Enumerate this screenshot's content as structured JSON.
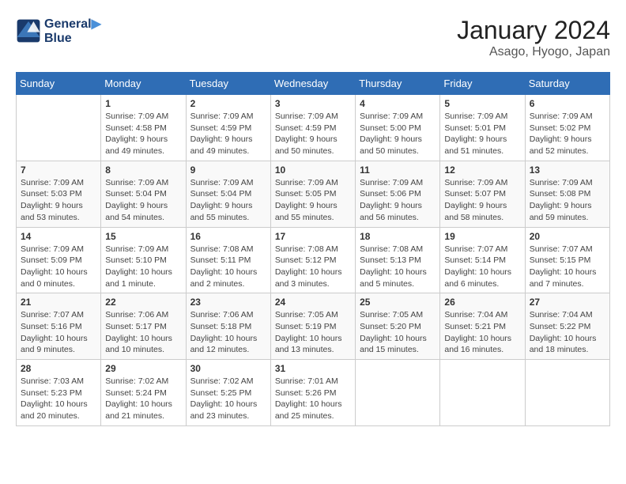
{
  "header": {
    "logo_line1": "General",
    "logo_line2": "Blue",
    "title": "January 2024",
    "subtitle": "Asago, Hyogo, Japan"
  },
  "days_of_week": [
    "Sunday",
    "Monday",
    "Tuesday",
    "Wednesday",
    "Thursday",
    "Friday",
    "Saturday"
  ],
  "weeks": [
    [
      {
        "day": "",
        "info": ""
      },
      {
        "day": "1",
        "info": "Sunrise: 7:09 AM\nSunset: 4:58 PM\nDaylight: 9 hours\nand 49 minutes."
      },
      {
        "day": "2",
        "info": "Sunrise: 7:09 AM\nSunset: 4:59 PM\nDaylight: 9 hours\nand 49 minutes."
      },
      {
        "day": "3",
        "info": "Sunrise: 7:09 AM\nSunset: 4:59 PM\nDaylight: 9 hours\nand 50 minutes."
      },
      {
        "day": "4",
        "info": "Sunrise: 7:09 AM\nSunset: 5:00 PM\nDaylight: 9 hours\nand 50 minutes."
      },
      {
        "day": "5",
        "info": "Sunrise: 7:09 AM\nSunset: 5:01 PM\nDaylight: 9 hours\nand 51 minutes."
      },
      {
        "day": "6",
        "info": "Sunrise: 7:09 AM\nSunset: 5:02 PM\nDaylight: 9 hours\nand 52 minutes."
      }
    ],
    [
      {
        "day": "7",
        "info": "Sunrise: 7:09 AM\nSunset: 5:03 PM\nDaylight: 9 hours\nand 53 minutes."
      },
      {
        "day": "8",
        "info": "Sunrise: 7:09 AM\nSunset: 5:04 PM\nDaylight: 9 hours\nand 54 minutes."
      },
      {
        "day": "9",
        "info": "Sunrise: 7:09 AM\nSunset: 5:04 PM\nDaylight: 9 hours\nand 55 minutes."
      },
      {
        "day": "10",
        "info": "Sunrise: 7:09 AM\nSunset: 5:05 PM\nDaylight: 9 hours\nand 55 minutes."
      },
      {
        "day": "11",
        "info": "Sunrise: 7:09 AM\nSunset: 5:06 PM\nDaylight: 9 hours\nand 56 minutes."
      },
      {
        "day": "12",
        "info": "Sunrise: 7:09 AM\nSunset: 5:07 PM\nDaylight: 9 hours\nand 58 minutes."
      },
      {
        "day": "13",
        "info": "Sunrise: 7:09 AM\nSunset: 5:08 PM\nDaylight: 9 hours\nand 59 minutes."
      }
    ],
    [
      {
        "day": "14",
        "info": "Sunrise: 7:09 AM\nSunset: 5:09 PM\nDaylight: 10 hours\nand 0 minutes."
      },
      {
        "day": "15",
        "info": "Sunrise: 7:09 AM\nSunset: 5:10 PM\nDaylight: 10 hours\nand 1 minute."
      },
      {
        "day": "16",
        "info": "Sunrise: 7:08 AM\nSunset: 5:11 PM\nDaylight: 10 hours\nand 2 minutes."
      },
      {
        "day": "17",
        "info": "Sunrise: 7:08 AM\nSunset: 5:12 PM\nDaylight: 10 hours\nand 3 minutes."
      },
      {
        "day": "18",
        "info": "Sunrise: 7:08 AM\nSunset: 5:13 PM\nDaylight: 10 hours\nand 5 minutes."
      },
      {
        "day": "19",
        "info": "Sunrise: 7:07 AM\nSunset: 5:14 PM\nDaylight: 10 hours\nand 6 minutes."
      },
      {
        "day": "20",
        "info": "Sunrise: 7:07 AM\nSunset: 5:15 PM\nDaylight: 10 hours\nand 7 minutes."
      }
    ],
    [
      {
        "day": "21",
        "info": "Sunrise: 7:07 AM\nSunset: 5:16 PM\nDaylight: 10 hours\nand 9 minutes."
      },
      {
        "day": "22",
        "info": "Sunrise: 7:06 AM\nSunset: 5:17 PM\nDaylight: 10 hours\nand 10 minutes."
      },
      {
        "day": "23",
        "info": "Sunrise: 7:06 AM\nSunset: 5:18 PM\nDaylight: 10 hours\nand 12 minutes."
      },
      {
        "day": "24",
        "info": "Sunrise: 7:05 AM\nSunset: 5:19 PM\nDaylight: 10 hours\nand 13 minutes."
      },
      {
        "day": "25",
        "info": "Sunrise: 7:05 AM\nSunset: 5:20 PM\nDaylight: 10 hours\nand 15 minutes."
      },
      {
        "day": "26",
        "info": "Sunrise: 7:04 AM\nSunset: 5:21 PM\nDaylight: 10 hours\nand 16 minutes."
      },
      {
        "day": "27",
        "info": "Sunrise: 7:04 AM\nSunset: 5:22 PM\nDaylight: 10 hours\nand 18 minutes."
      }
    ],
    [
      {
        "day": "28",
        "info": "Sunrise: 7:03 AM\nSunset: 5:23 PM\nDaylight: 10 hours\nand 20 minutes."
      },
      {
        "day": "29",
        "info": "Sunrise: 7:02 AM\nSunset: 5:24 PM\nDaylight: 10 hours\nand 21 minutes."
      },
      {
        "day": "30",
        "info": "Sunrise: 7:02 AM\nSunset: 5:25 PM\nDaylight: 10 hours\nand 23 minutes."
      },
      {
        "day": "31",
        "info": "Sunrise: 7:01 AM\nSunset: 5:26 PM\nDaylight: 10 hours\nand 25 minutes."
      },
      {
        "day": "",
        "info": ""
      },
      {
        "day": "",
        "info": ""
      },
      {
        "day": "",
        "info": ""
      }
    ]
  ]
}
